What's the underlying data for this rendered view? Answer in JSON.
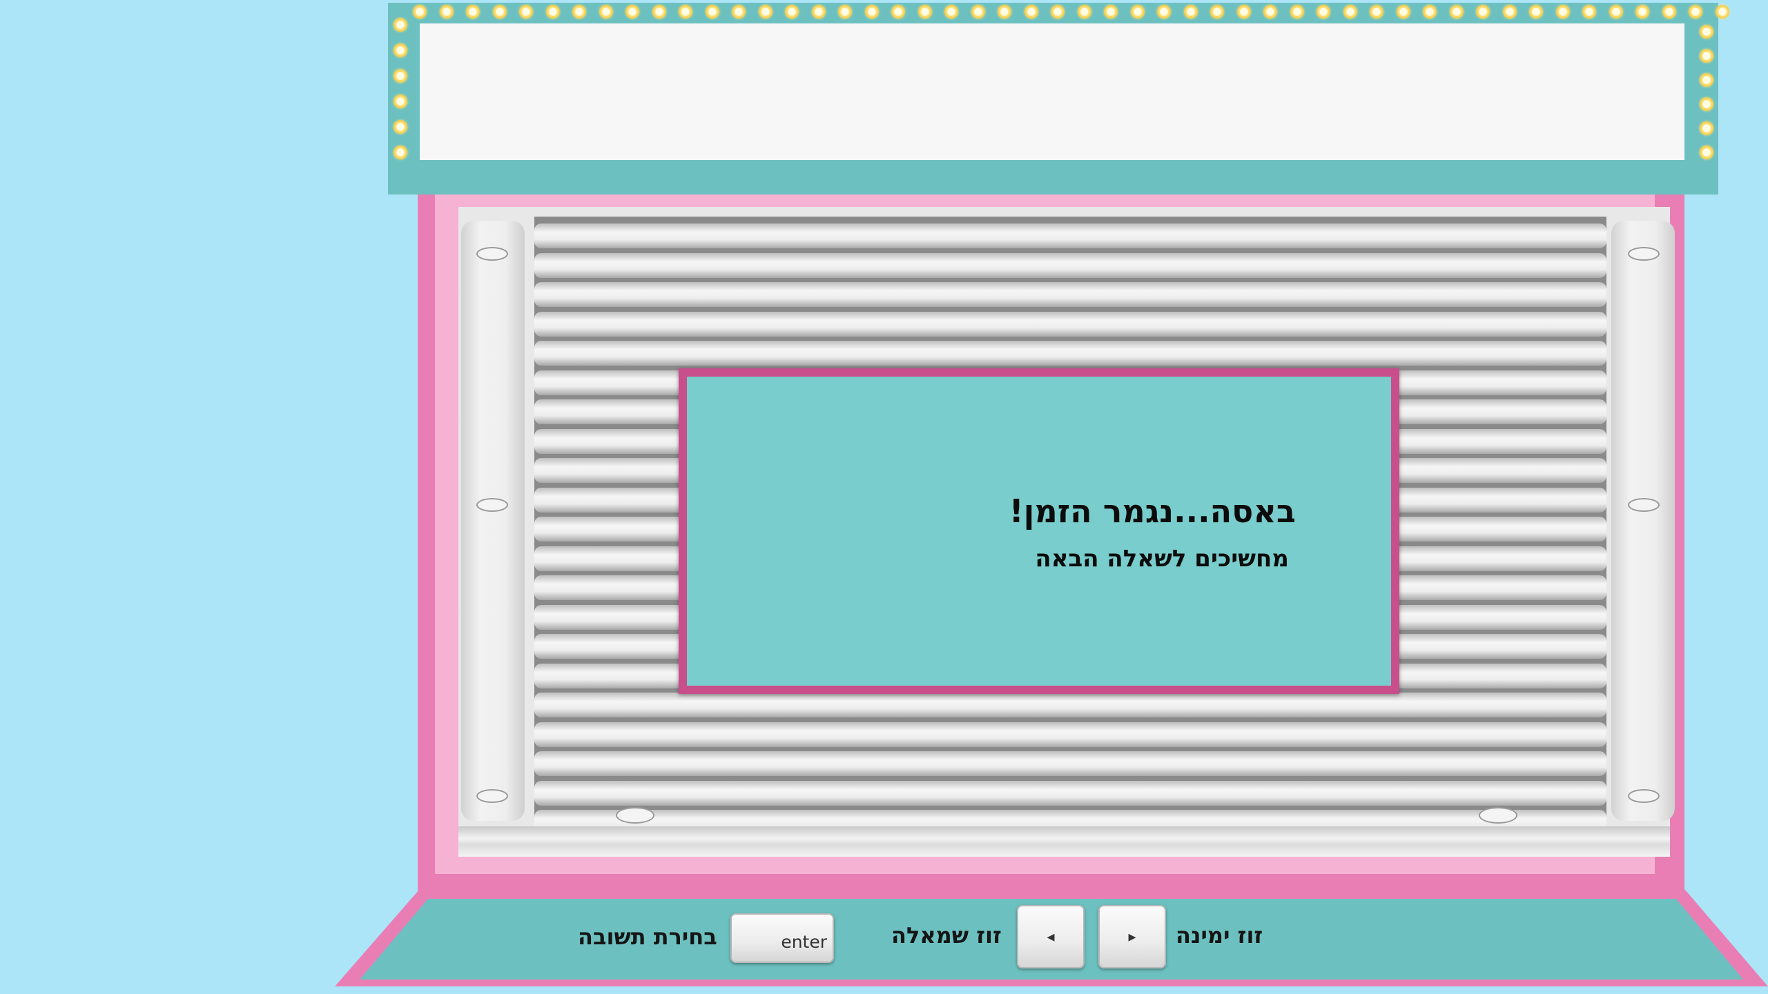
{
  "message": {
    "title": "באסה...נגמר הזמן!",
    "subtitle": "מחשיכים לשאלה הבאה"
  },
  "controls": {
    "move_right_label": "זוז ימינה",
    "move_left_label": "זוז שמאלה",
    "choose_answer_label": "בחירת תשובה",
    "right_key_glyph": "▸",
    "left_key_glyph": "◂",
    "enter_key_label": "enter"
  },
  "colors": {
    "background": "#ace5f8",
    "marquee": "#6dc0c0",
    "cabinet": "#e97eb4",
    "panel_screen": "#79cdcc",
    "panel_border": "#c84e8c",
    "bulb": "#f3c94a"
  }
}
